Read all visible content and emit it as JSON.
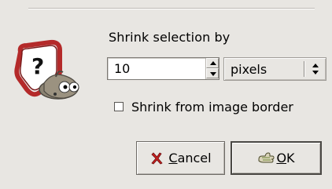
{
  "dialog": {
    "prompt_label": "Shrink selection by",
    "amount": {
      "value": "10"
    },
    "unit": {
      "selected": "pixels",
      "options": [
        "pixels"
      ]
    },
    "border_option": {
      "label": "Shrink from image border",
      "checked": false
    }
  },
  "buttons": {
    "cancel": {
      "mnemonic": "C",
      "rest": "ancel"
    },
    "ok": {
      "mnemonic": "O",
      "rest": "K"
    }
  },
  "icons": {
    "dialog_icon": "help-question-icon",
    "cancel_icon": "cancel-x-icon",
    "ok_icon": "ok-hand-icon"
  },
  "colors": {
    "window_bg": "#e8e6e2",
    "cancel_icon_color": "#c81f1f",
    "question_sign_red": "#b42a2a",
    "ok_icon_green": "#6f8a3a"
  }
}
